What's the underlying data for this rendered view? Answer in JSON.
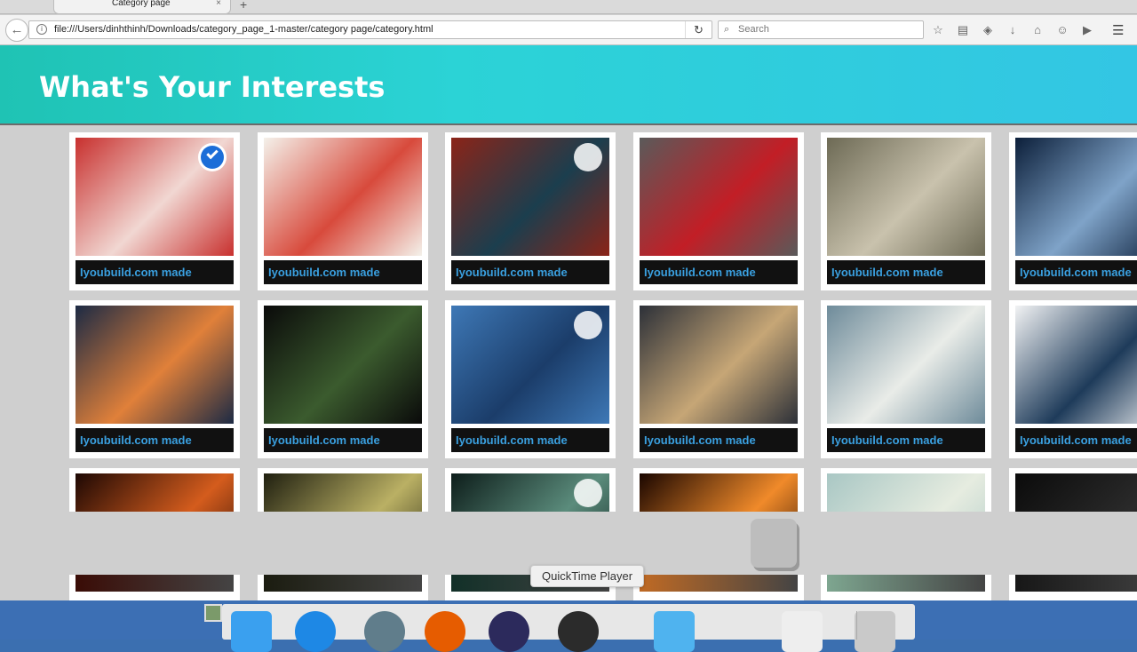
{
  "browser": {
    "tab_title": "Category page",
    "tab_close": "×",
    "new_tab": "+",
    "url": "file:///Users/dinhthinh/Downloads/category_page_1-master/category page/category.html",
    "search_placeholder": "Search",
    "back_glyph": "←",
    "reload_glyph": "↻",
    "info_glyph": "i",
    "menu_glyph": "☰"
  },
  "page": {
    "title": "What's Your Interests"
  },
  "cards": [
    {
      "caption": "Iyoubuild.com made",
      "selected": true,
      "check": "on",
      "c1": "#c8302e",
      "c2": "#f1d7d2"
    },
    {
      "caption": "Iyoubuild.com made",
      "selected": false,
      "check": "none",
      "c1": "#f4f1ea",
      "c2": "#d84a3c"
    },
    {
      "caption": "Iyoubuild.com made",
      "selected": false,
      "check": "off",
      "c1": "#8b2418",
      "c2": "#1b3e4e"
    },
    {
      "caption": "Iyoubuild.com made",
      "selected": false,
      "check": "none",
      "c1": "#5a5a5a",
      "c2": "#c21e26"
    },
    {
      "caption": "Iyoubuild.com made",
      "selected": false,
      "check": "none",
      "c1": "#6d6a55",
      "c2": "#c9c2ad"
    },
    {
      "caption": "Iyoubuild.com made",
      "selected": false,
      "check": "none",
      "c1": "#0c1f3a",
      "c2": "#7fa3c8"
    },
    {
      "caption": "Iyoubuild.com made",
      "selected": false,
      "check": "none",
      "c1": "#1c2a44",
      "c2": "#e0803a"
    },
    {
      "caption": "Iyoubuild.com made",
      "selected": false,
      "check": "none",
      "c1": "#0a0a0a",
      "c2": "#3b5b2e"
    },
    {
      "caption": "Iyoubuild.com made",
      "selected": false,
      "check": "off",
      "c1": "#3e78b6",
      "c2": "#1b3d6a"
    },
    {
      "caption": "Iyoubuild.com made",
      "selected": false,
      "check": "none",
      "c1": "#2c3038",
      "c2": "#c6a676"
    },
    {
      "caption": "Iyoubuild.com made",
      "selected": false,
      "check": "none",
      "c1": "#6e8b9a",
      "c2": "#e9ece8"
    },
    {
      "caption": "Iyoubuild.com made",
      "selected": false,
      "check": "none",
      "c1": "#f2f3f4",
      "c2": "#1e3b5a"
    },
    {
      "caption": "",
      "selected": false,
      "check": "none",
      "c1": "#1d0804",
      "c2": "#d45c1d"
    },
    {
      "caption": "",
      "selected": false,
      "check": "none",
      "c1": "#1f1f10",
      "c2": "#bab064"
    },
    {
      "caption": "",
      "selected": false,
      "check": "off",
      "c1": "#0d1d1a",
      "c2": "#5b8c7c"
    },
    {
      "caption": "",
      "selected": false,
      "check": "none",
      "c1": "#1a0600",
      "c2": "#f08a2a"
    },
    {
      "caption": "",
      "selected": false,
      "check": "none",
      "c1": "#a9c7c4",
      "c2": "#e6ece0"
    },
    {
      "caption": "",
      "selected": false,
      "check": "none",
      "c1": "#0b0b0b",
      "c2": "#2a2a2a"
    }
  ],
  "strip_colors": [
    "#3a0c06",
    "#1b1c10",
    "#123028",
    "#c06a24",
    "#7ea690",
    "#171717"
  ],
  "tooltip": "QuickTime Player",
  "toolbar_icons": [
    "star-icon",
    "reading-list-icon",
    "pocket-icon",
    "download-icon",
    "home-icon",
    "chat-icon",
    "youtube-icon"
  ],
  "toolbar_glyphs": [
    "☆",
    "▤",
    "◈",
    "↓",
    "⌂",
    "☺",
    "▶"
  ],
  "dock": [
    "finder",
    "safari",
    "preview",
    "firefox",
    "eclipse",
    "quicktime",
    "folder",
    "window",
    "trash"
  ]
}
